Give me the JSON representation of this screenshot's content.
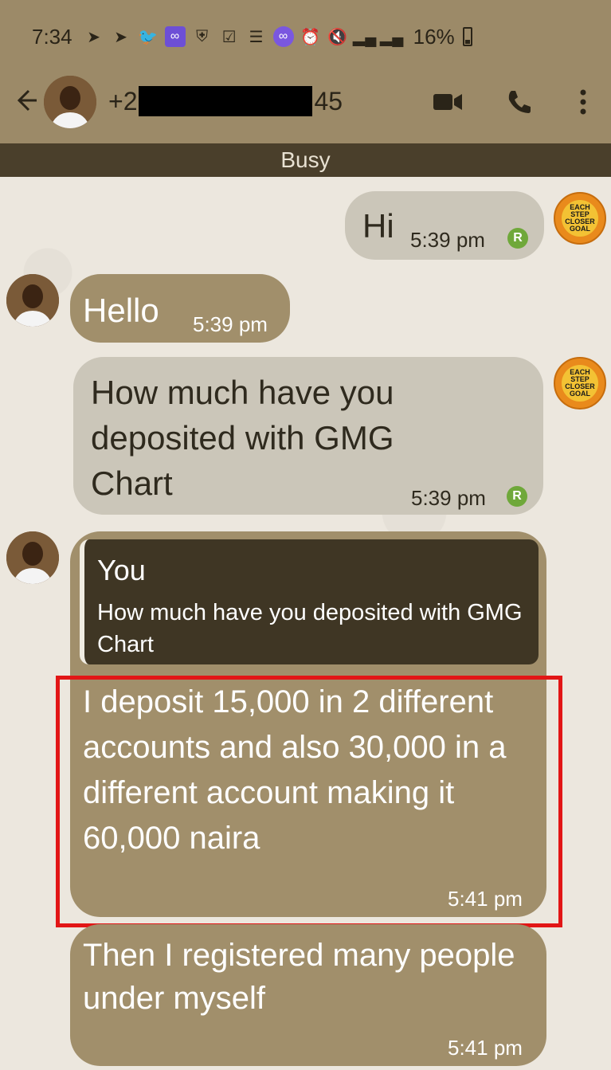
{
  "status_bar": {
    "time": "7:34",
    "battery": "16%",
    "icons": [
      "telegram-icon",
      "telegram-icon",
      "twitter-icon",
      "link-app-icon",
      "shield-icon",
      "checkbox-icon",
      "news-icon",
      "link-app-icon",
      "alarm-icon",
      "mute-icon",
      "signal-icon",
      "signal-icon"
    ]
  },
  "header": {
    "contact_prefix": "+2",
    "contact_suffix": "45",
    "back_icon": "arrow-left-icon",
    "video_icon": "video-call-icon",
    "call_icon": "phone-icon",
    "more_icon": "more-vertical-icon"
  },
  "status_banner": "Busy",
  "messages": [
    {
      "side": "out",
      "text": "Hi",
      "time": "5:39 pm",
      "read_badge": "R"
    },
    {
      "side": "in",
      "text": "Hello",
      "time": "5:39 pm"
    },
    {
      "side": "out",
      "text": "How much have you deposited with GMG Chart",
      "time": "5:39 pm",
      "read_badge": "R"
    },
    {
      "side": "in",
      "quote_name": "You",
      "quote_text": "How much have you deposited with GMG Chart",
      "text": "I deposit 15,000 in 2 different accounts and also 30,000 in a different account making it 60,000 naira",
      "time": "5:41 pm"
    },
    {
      "side": "in",
      "text": "Then I registered many people under myself",
      "time": "5:41 pm"
    }
  ],
  "avatar_goal_text": [
    "EACH STEP",
    "CLOSER",
    "GOAL"
  ],
  "colors": {
    "header": "#9c8a68",
    "busy_bar": "#4a3f2b",
    "outgoing": "#cbc6b9",
    "incoming": "#a18f6b",
    "highlight": "#e21616"
  }
}
